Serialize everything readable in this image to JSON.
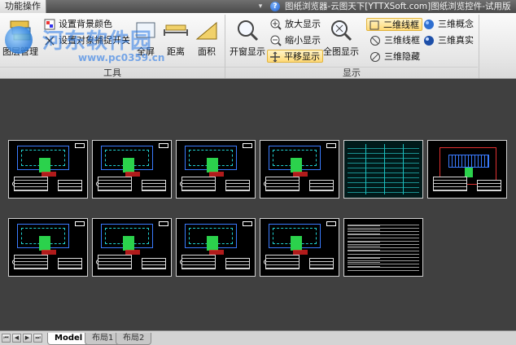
{
  "window": {
    "active_tab": "功能操作",
    "title": "图纸浏览器-云图天下[YTTXSoft.com]图纸浏览控件-试用版"
  },
  "watermark": {
    "text": "河东软件园",
    "url": "www.pc0359.cn"
  },
  "ribbon": {
    "tools_group": {
      "label": "工具",
      "layer_manager": "图层管理",
      "set_bg_color": "设置背景颜色",
      "set_snap": "设置对象捕捉开关",
      "fullscreen": "全屏",
      "distance": "距离",
      "area": "面积"
    },
    "display_group": {
      "label": "显示",
      "window_display": "开窗显示",
      "zoom_in": "放大显示",
      "zoom_out": "缩小显示",
      "pan": "平移显示",
      "full_display": "全图显示",
      "wire_2d": "二维线框",
      "wire_3d": "三维线框",
      "hidden_3d": "三维隐藏",
      "concept_3d": "三维概念",
      "realistic_3d": "三维真实"
    }
  },
  "drawings": {
    "row1": [
      "plan",
      "plan",
      "plan",
      "plan",
      "schedule",
      "site"
    ],
    "row2": [
      "plan",
      "plan",
      "plan",
      "plan",
      "notes"
    ]
  },
  "layout_tabs": [
    "Model",
    "布局1",
    "布局2"
  ]
}
